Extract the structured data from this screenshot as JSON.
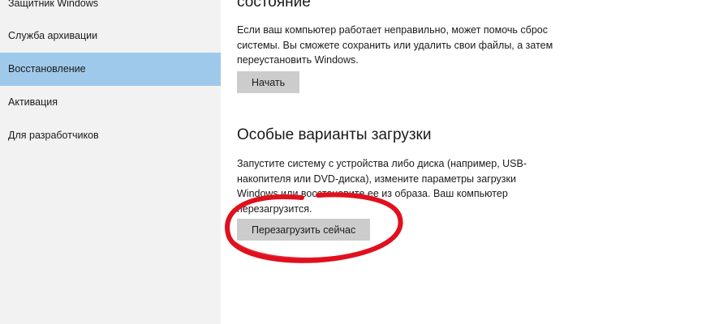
{
  "sidebar": {
    "items": [
      {
        "label": "Защитник Windows",
        "selected": false
      },
      {
        "label": "Служба архивации",
        "selected": false
      },
      {
        "label": "Восстановление",
        "selected": true
      },
      {
        "label": "Активация",
        "selected": false
      },
      {
        "label": "Для разработчиков",
        "selected": false
      }
    ]
  },
  "reset": {
    "title": "состояние",
    "description": "Если ваш компьютер работает неправильно, может помочь сброс системы. Вы сможете сохранить или удалить свои файлы, а затем переустановить Windows.",
    "button_label": "Начать"
  },
  "advanced": {
    "title": "Особые варианты загрузки",
    "description": "Запустите систему с устройства либо диска (например, USB-накопителя или DVD-диска), измените параметры загрузки Windows или восстановите ее из образа. Ваш компьютер перезагрузится.",
    "button_label": "Перезагрузить сейчас"
  },
  "colors": {
    "sidebar_bg": "#f2f2f2",
    "selected_bg": "#9fc9ea",
    "button_bg": "#cccccc",
    "annotation": "#e0101e"
  }
}
